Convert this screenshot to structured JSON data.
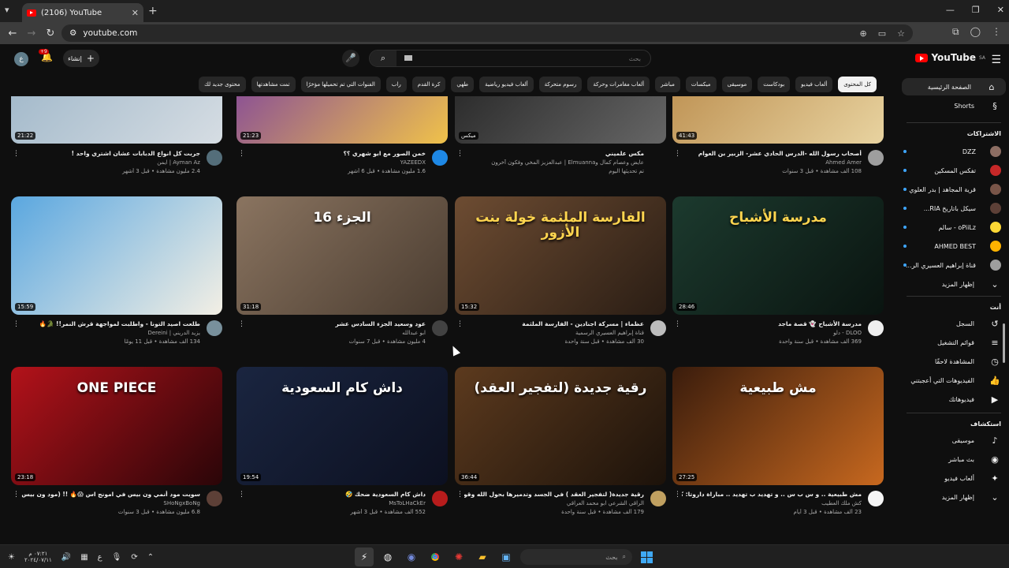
{
  "browser": {
    "tab_title": "(2106) YouTube",
    "url": "youtube.com"
  },
  "topbar": {
    "avatar_letter": "ع",
    "notifications": "+9",
    "create_label": "إنشاء",
    "search_placeholder": "بحث"
  },
  "chips": [
    "كل المحتوى",
    "ألعاب فيديو",
    "بودكاست",
    "موسيقى",
    "ميكسات",
    "مباشر",
    "ألعاب مغامرات وحركة",
    "رسوم متحركة",
    "ألعاب فيديو رياضية",
    "طهي",
    "كرة القدم",
    "راب",
    "الفنوات التي تم تحميلها مؤخرًا",
    "تمت مشاهدتها",
    "محتوى جديد لك"
  ],
  "sidebar": {
    "logo": "YouTube",
    "country": "SA",
    "nav": [
      {
        "label": "الصفحة الرئيسية",
        "icon": "home-icon",
        "glyph": "⌂"
      },
      {
        "label": "Shorts",
        "icon": "shorts-icon",
        "glyph": "§"
      }
    ],
    "subs_header": "الاشتراكات",
    "subs": [
      {
        "label": "DZZ",
        "color": "#8d6e63"
      },
      {
        "label": "تفكس المسكين",
        "color": "#c62828"
      },
      {
        "label": "قرية المجاهد | بدر العلوي",
        "color": "#795548"
      },
      {
        "label": "سيكل باتاريخ RIA...",
        "color": "#5d4037"
      },
      {
        "label": "oPiiLz - سالم",
        "color": "#fdd835"
      },
      {
        "label": "AHMED BEST",
        "color": "#ffb300"
      },
      {
        "label": "قناة إبراهيم العسيري الر...",
        "color": "#9e9e9e"
      }
    ],
    "subs_more": "إظهار المزيد",
    "you_header": "أنت",
    "you": [
      {
        "label": "السجل",
        "glyph": "↺"
      },
      {
        "label": "قوائم التشغيل",
        "glyph": "≡"
      },
      {
        "label": "المشاهدة لاحقًا",
        "glyph": "◷"
      },
      {
        "label": "الفيديوهات التي أعجبتني",
        "glyph": "👍"
      },
      {
        "label": "فيديوهاتك",
        "glyph": "▶"
      }
    ],
    "explore_header": "استكشاف",
    "explore": [
      {
        "label": "موسيقى",
        "glyph": "♪"
      },
      {
        "label": "بث مباشر",
        "glyph": "◉"
      },
      {
        "label": "ألعاب فيديو",
        "glyph": "✦"
      },
      {
        "label": "إظهار المزيد",
        "glyph": "⌄"
      }
    ]
  },
  "videos": [
    {
      "title": "أصحاب رسول الله -الدرس الحادي عشر- الزبير بن العوام",
      "channel": "Ahmed Amer",
      "stats": "108 ألف مشاهدة • قبل 3 سنوات",
      "duration": "41:43",
      "overlay": "",
      "colors": [
        "#b98a4a",
        "#e8d3a0"
      ],
      "ccolor": "#9e9e9e"
    },
    {
      "title": "مكس علميني",
      "channel": "عايض وعصام كمال وElmuanna | عبدالعزيز المخي وفكون آخرون",
      "stats": "تم تحديثها اليوم",
      "duration": "ميكس",
      "overlay": "",
      "colors": [
        "#222",
        "#666"
      ],
      "ccolor": ""
    },
    {
      "title": "خمن الصور مع ابو شهري ؟؟",
      "channel": "YAZEEDX",
      "stats": "1.6 مليون مشاهدة • قبل 6 أشهر",
      "duration": "21:23",
      "overlay": "",
      "colors": [
        "#7b3fa0",
        "#f0c24a"
      ],
      "ccolor": "#1e88e5"
    },
    {
      "title": "جربت كل انواع الدبابات عشان اشتري واحد !",
      "channel": "Ayman Az | ايمن",
      "stats": "2.4 مليون مشاهدة • قبل 3 أشهر",
      "duration": "21:22",
      "overlay": "",
      "colors": [
        "#9bb4c7",
        "#d6dde3"
      ],
      "ccolor": "#546e7a"
    },
    {
      "title": "مدرسة الأشباح 👻 قصة ماجد",
      "channel": "DLOO - دلو",
      "stats": "369 ألف مشاهدة • قبل سنة واحدة",
      "duration": "28:46",
      "overlay": "مدرسة الأشباح",
      "colors": [
        "#1c3a2e",
        "#0a1410"
      ],
      "ccolor": "#eeeeee"
    },
    {
      "title": "عظماء | مسركة اجنادين - الفارسة الملثمة",
      "channel": "قناة إبراهيم العسيري الرسمية",
      "stats": "30 ألف مشاهدة • قبل سنة واحدة",
      "duration": "15:32",
      "overlay": "الفارسة الملثمة خولة بنت الأزور",
      "colors": [
        "#6d4c32",
        "#2a1d14"
      ],
      "ccolor": "#bdbdbd"
    },
    {
      "title": "عود وسعيد الجزء السادس عشر",
      "channel": "ابو عبدالله",
      "stats": "4 مليون مشاهدة • قبل 7 سنوات",
      "duration": "31:18",
      "overlay": "الجزء 16",
      "colors": [
        "#8a7460",
        "#4a3c30"
      ],
      "ccolor": "#424242"
    },
    {
      "title": "طلعت اصيد التونا - واطلبت لمواجهة قرش النمر!! 🐊🔥",
      "channel": "يزيد الدريني | Dereini",
      "stats": "134 ألف مشاهدة • قبل 11 يومًا",
      "duration": "15:59",
      "overlay": "",
      "colors": [
        "#5aa7e0",
        "#f3efe4"
      ],
      "ccolor": "#78909c"
    },
    {
      "title": "مش طبيعية .. و س ب س .. و تهديد ب تهديد .. مباراة داروتا: كارلسن ضد نيمان",
      "channel": "كش ملك العطيب",
      "stats": "23 ألف مشاهدة • قبل 3 أيام",
      "duration": "27:25",
      "overlay": "مش طبيعية",
      "colors": [
        "#3a1c0c",
        "#c7681f"
      ],
      "ccolor": "#f5f5f5"
    },
    {
      "title": "رقية جديدة( لتفجير العقد ) في الجسد وتدميرها بحول الله وقوته",
      "channel": "الراقي الشرعي ابو محمد العراقي",
      "stats": "179 ألف مشاهدة • قبل سنة واحدة",
      "duration": "36:44",
      "overlay": "رقية جديدة (لتفجير العقد)",
      "colors": [
        "#5c3a1e",
        "#1c120a"
      ],
      "ccolor": "#c0a060"
    },
    {
      "title": "داش كام السعودية ضحك 🤣",
      "channel": "MsToLHaCkEr",
      "stats": "552 ألف مشاهدة • قبل 3 أشهر",
      "duration": "19:54",
      "overlay": "داش كام السعودية",
      "colors": [
        "#1a2540",
        "#0c1020"
      ],
      "ccolor": "#b71c1c"
    },
    {
      "title": "سويت مود أنمي ون بيس في امونج اس 😱🔥 !! (مود ون بيس الأسطوري 😮)",
      "channel": "SHoNgxBoNg",
      "stats": "6.8 مليون مشاهدة • قبل 3 سنوات",
      "duration": "23:18",
      "overlay": "ONE PIECE",
      "colors": [
        "#b3121a",
        "#2a0508"
      ],
      "ccolor": "#5d4037"
    }
  ],
  "taskbar": {
    "time": "٠٧:٢١ م",
    "date": "٢٠٢٤/٠٧/١١",
    "lang": "ع",
    "search": "بحث"
  }
}
